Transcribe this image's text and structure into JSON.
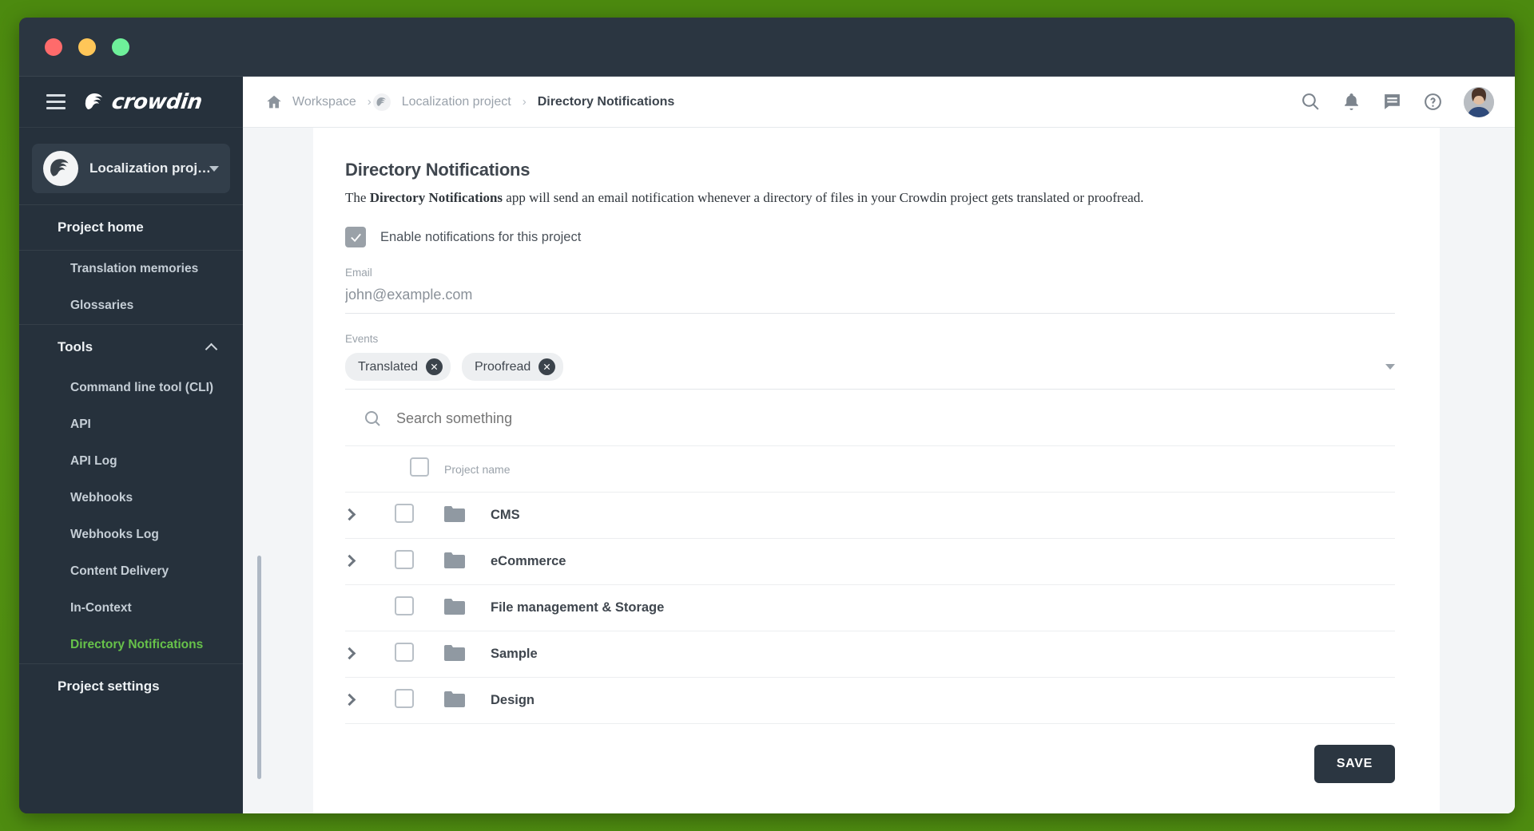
{
  "window": {
    "traffic_lights": [
      "close",
      "minimize",
      "zoom"
    ],
    "colors": {
      "close": "#ff6b6b",
      "minimize": "#ffc658",
      "zoom": "#6ef09a",
      "chrome": "#2b3641",
      "sidebar": "#26313c",
      "accent_green": "#67c24a",
      "desktop": "#4e8c10"
    }
  },
  "sidebar": {
    "brand": "crowdin",
    "project_selector": {
      "name": "Localization proj…"
    },
    "groups": [
      {
        "title": "Project home",
        "collapsible": false,
        "items": [
          {
            "label": "Translation memories",
            "active": false
          },
          {
            "label": "Glossaries",
            "active": false
          }
        ]
      },
      {
        "title": "Tools",
        "collapsible": true,
        "items": [
          {
            "label": "Command line tool (CLI)",
            "active": false
          },
          {
            "label": "API",
            "active": false
          },
          {
            "label": "API Log",
            "active": false
          },
          {
            "label": "Webhooks",
            "active": false
          },
          {
            "label": "Webhooks Log",
            "active": false
          },
          {
            "label": "Content Delivery",
            "active": false
          },
          {
            "label": "In-Context",
            "active": false
          },
          {
            "label": "Directory Notifications",
            "active": true
          }
        ]
      },
      {
        "title": "Project settings",
        "collapsible": false,
        "items": []
      }
    ]
  },
  "topbar": {
    "breadcrumb": [
      {
        "label": "Workspace",
        "icon": "home-icon",
        "current": false
      },
      {
        "label": "Localization project",
        "icon": "project-icon",
        "current": false
      },
      {
        "label": "Directory Notifications",
        "icon": null,
        "current": true
      }
    ],
    "separator": "›",
    "icons": [
      "search-icon",
      "bell-icon",
      "chat-icon",
      "help-icon"
    ]
  },
  "main": {
    "title": "Directory Notifications",
    "description_prefix": "The ",
    "description_bold": "Directory Notifications",
    "description_suffix": " app will send an email notification whenever a directory of files in your Crowdin project gets translated or proofread.",
    "enable_checkbox": {
      "label": "Enable notifications for this project",
      "checked": true
    },
    "email": {
      "label": "Email",
      "value": "john@example.com",
      "placeholder": "john@example.com"
    },
    "events": {
      "label": "Events",
      "chips": [
        "Translated",
        "Proofread"
      ]
    },
    "search": {
      "placeholder": "Search something",
      "value": ""
    },
    "table": {
      "header": {
        "select_all": false,
        "name_column": "Project name"
      },
      "rows": [
        {
          "name": "CMS",
          "expandable": true,
          "checked": false
        },
        {
          "name": "eCommerce",
          "expandable": true,
          "checked": false
        },
        {
          "name": "File management & Storage",
          "expandable": false,
          "checked": false
        },
        {
          "name": "Sample",
          "expandable": true,
          "checked": false
        },
        {
          "name": "Design",
          "expandable": true,
          "checked": false
        }
      ]
    },
    "save_label": "SAVE"
  }
}
